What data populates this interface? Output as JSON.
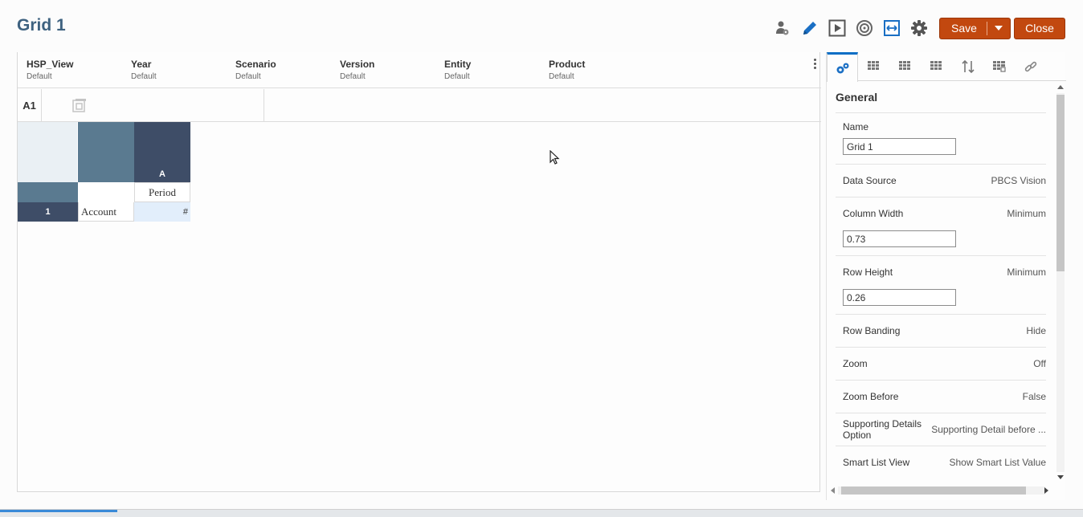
{
  "header": {
    "title": "Grid 1",
    "save_label": "Save",
    "close_label": "Close"
  },
  "pov": [
    {
      "name": "HSP_View",
      "value": "Default"
    },
    {
      "name": "Year",
      "value": "Default"
    },
    {
      "name": "Scenario",
      "value": "Default"
    },
    {
      "name": "Version",
      "value": "Default"
    },
    {
      "name": "Entity",
      "value": "Default"
    },
    {
      "name": "Product",
      "value": "Default"
    }
  ],
  "formula_bar": {
    "cell_ref": "A1"
  },
  "grid": {
    "column_header": "A",
    "row_header": "1",
    "column_dimension": "Period",
    "row_dimension": "Account",
    "data_cell": "#"
  },
  "panel": {
    "section": "General",
    "props": {
      "name_label": "Name",
      "name_value": "Grid 1",
      "data_source_label": "Data Source",
      "data_source_value": "PBCS Vision",
      "column_width_label": "Column Width",
      "column_width_mode": "Minimum",
      "column_width_value": "0.73",
      "row_height_label": "Row Height",
      "row_height_mode": "Minimum",
      "row_height_value": "0.26",
      "row_banding_label": "Row Banding",
      "row_banding_value": "Hide",
      "zoom_label": "Zoom",
      "zoom_value": "Off",
      "zoom_before_label": "Zoom Before",
      "zoom_before_value": "False",
      "supporting_details_label_1": "Supporting Details",
      "supporting_details_label_2": "Option",
      "supporting_details_value": "Supporting Detail before ...",
      "smart_list_label": "Smart List View",
      "smart_list_value": "Show Smart List Value"
    }
  },
  "colors": {
    "accent": "#c2480f",
    "title": "#3e6280",
    "grid_dark": "#3e4d67",
    "grid_mid": "#5a7a90",
    "grid_light": "#eaf0f4",
    "tab_active": "#0a6ec5"
  }
}
